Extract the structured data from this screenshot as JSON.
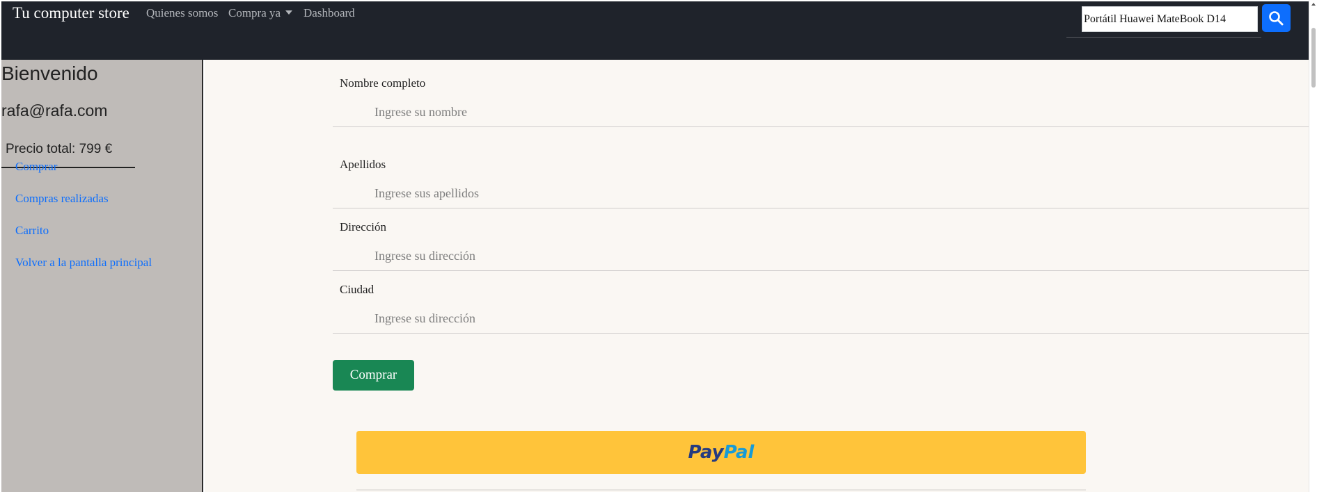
{
  "navbar": {
    "brand": "Tu computer store",
    "links": [
      "Quienes somos",
      "Compra ya",
      "Dashboard"
    ],
    "search_value": "Portátil Huawei MateBook D14",
    "search_icon": "search-icon",
    "background": "#1f232b",
    "search_button_color": "#0d6efd"
  },
  "sidebar": {
    "welcome": "Bienvenido",
    "email": "rafa@rafa.com",
    "price": "Precio total: 799 €",
    "links": [
      "Comprar",
      "Compras realizadas",
      "Carrito",
      "Volver a la pantalla principal"
    ],
    "background": "#bfbbb8",
    "link_color": "#0d6efd"
  },
  "form": {
    "fields": [
      {
        "label": "Nombre completo",
        "placeholder": "Ingrese su nombre"
      },
      {
        "label": "Apellidos",
        "placeholder": "Ingrese sus apellidos"
      },
      {
        "label": "Dirección",
        "placeholder": "Ingrese su dirección"
      },
      {
        "label": "Ciudad",
        "placeholder": "Ingrese su dirección"
      }
    ],
    "submit_label": "Comprar",
    "submit_color": "#198754"
  },
  "paypal": {
    "logo_part1": "Pay",
    "logo_part2": "Pal",
    "background": "#ffc43a"
  }
}
